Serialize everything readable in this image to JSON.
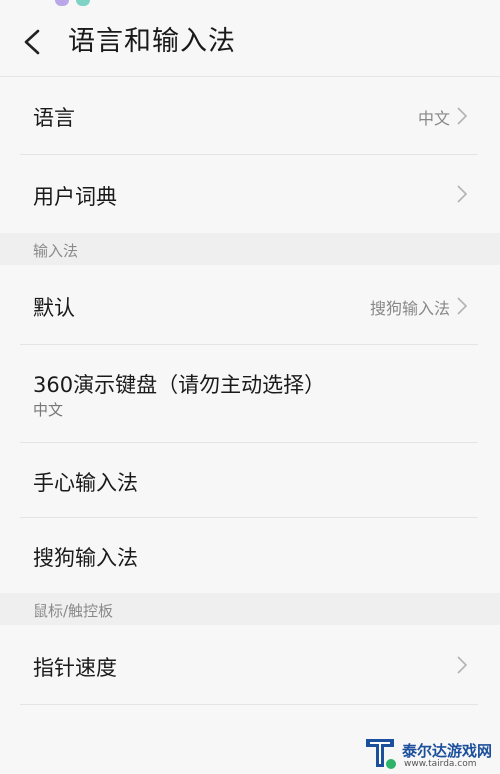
{
  "header": {
    "title": "语言和输入法"
  },
  "rows": {
    "language": {
      "label": "语言",
      "value": "中文"
    },
    "user_dictionary": {
      "label": "用户词典"
    },
    "default": {
      "label": "默认",
      "value": "搜狗输入法"
    },
    "keyboard_360": {
      "label": "360演示键盘（请勿主动选择）",
      "sublabel": "中文"
    },
    "shouxin": {
      "label": "手心输入法"
    },
    "sogou": {
      "label": "搜狗输入法"
    },
    "pointer_speed": {
      "label": "指针速度"
    }
  },
  "sections": {
    "input_methods": "输入法",
    "mouse_touchpad": "鼠标/触控板"
  },
  "watermark": {
    "text": "泰尔达游戏网",
    "url": "www.tairda.com"
  },
  "colors": {
    "background": "#f7f7f7",
    "section_background": "#efefef",
    "accent_watermark": "#1c4f9c"
  }
}
